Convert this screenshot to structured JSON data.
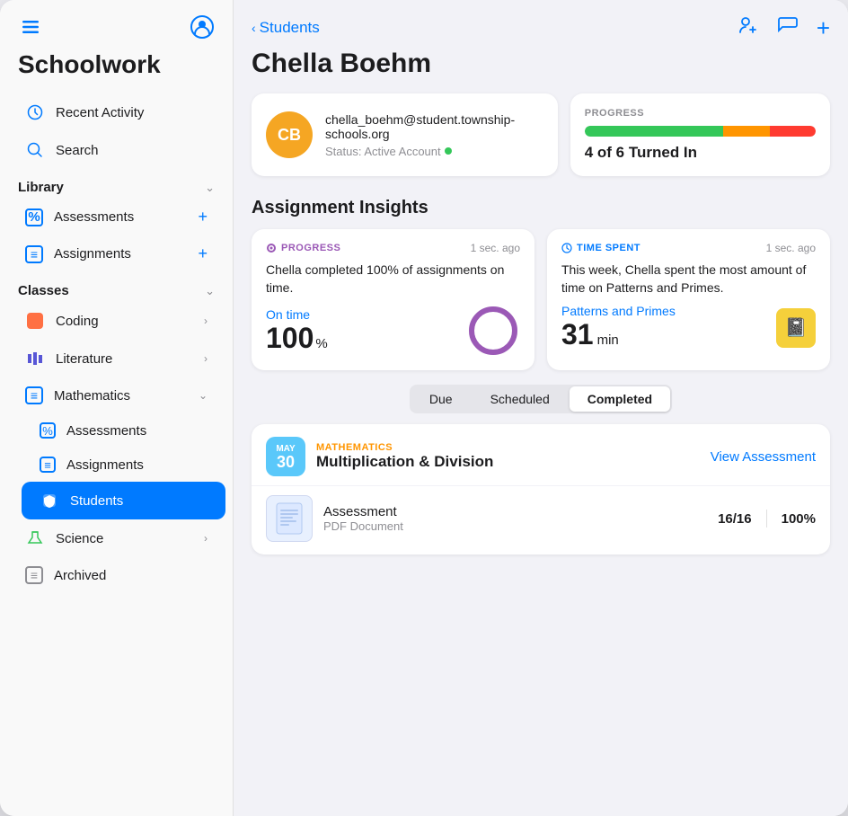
{
  "sidebar": {
    "title": "Schoolwork",
    "icons": {
      "sidebar_toggle": "▦",
      "account": "👤"
    },
    "library_section": {
      "label": "Library",
      "items": [
        {
          "id": "assessments",
          "icon": "％",
          "label": "Assessments",
          "action": "add"
        },
        {
          "id": "assignments",
          "icon": "☰",
          "label": "Assignments",
          "action": "add"
        }
      ]
    },
    "classes_section": {
      "label": "Classes",
      "items": [
        {
          "id": "coding",
          "icon": "🟧",
          "label": "Coding",
          "has_chevron": true
        },
        {
          "id": "literature",
          "icon": "📊",
          "label": "Literature",
          "has_chevron": true
        },
        {
          "id": "mathematics",
          "icon": "☰",
          "label": "Mathematics",
          "expanded": true,
          "sub_items": [
            {
              "id": "math-assessments",
              "icon": "％",
              "label": "Assessments"
            },
            {
              "id": "math-assignments",
              "icon": "☰",
              "label": "Assignments"
            },
            {
              "id": "math-students",
              "icon": "🎓",
              "label": "Students",
              "active": true
            }
          ]
        },
        {
          "id": "science",
          "icon": "✳",
          "label": "Science",
          "has_chevron": true
        }
      ]
    },
    "archived": {
      "icon": "☰",
      "label": "Archived"
    }
  },
  "main": {
    "breadcrumb": "Students",
    "student_name": "Chella Boehm",
    "header_actions": {
      "add_student": "add-student-icon",
      "message": "message-icon",
      "add": "add-icon"
    },
    "student_card": {
      "avatar_initials": "CB",
      "avatar_color": "#f5a623",
      "email": "chella_boehm@student.township-schools.org",
      "status_label": "Status: Active Account"
    },
    "progress_card": {
      "label": "PROGRESS",
      "bar_green_pct": 60,
      "bar_yellow_pct": 20,
      "bar_red_pct": 20,
      "turned_in_text": "4 of 6 Turned In"
    },
    "section_title": "Assignment Insights",
    "insight_progress": {
      "type_label": "PROGRESS",
      "time_label": "1 sec. ago",
      "description": "Chella completed 100% of assignments on time.",
      "metric_label": "On time",
      "metric_value": "100",
      "metric_unit": "%",
      "donut_color": "#9b59b6",
      "donut_pct": 100
    },
    "insight_time": {
      "type_label": "TIME SPENT",
      "time_label": "1 sec. ago",
      "description": "This week, Chella spent the most amount of time on Patterns and Primes.",
      "subject_label": "Patterns and Primes",
      "metric_value": "31",
      "metric_unit": "min"
    },
    "tabs": [
      {
        "id": "due",
        "label": "Due"
      },
      {
        "id": "scheduled",
        "label": "Scheduled"
      },
      {
        "id": "completed",
        "label": "Completed",
        "active": true
      }
    ],
    "assignment": {
      "date_month": "MAY",
      "date_day": "30",
      "date_color": "#5ac8fa",
      "subject": "MATHEMATICS",
      "subject_color": "#ff9500",
      "name": "Multiplication & Division",
      "view_button": "View Assessment",
      "doc": {
        "name": "Assessment",
        "type": "PDF Document",
        "score": "16/16",
        "percent": "100%"
      }
    }
  }
}
